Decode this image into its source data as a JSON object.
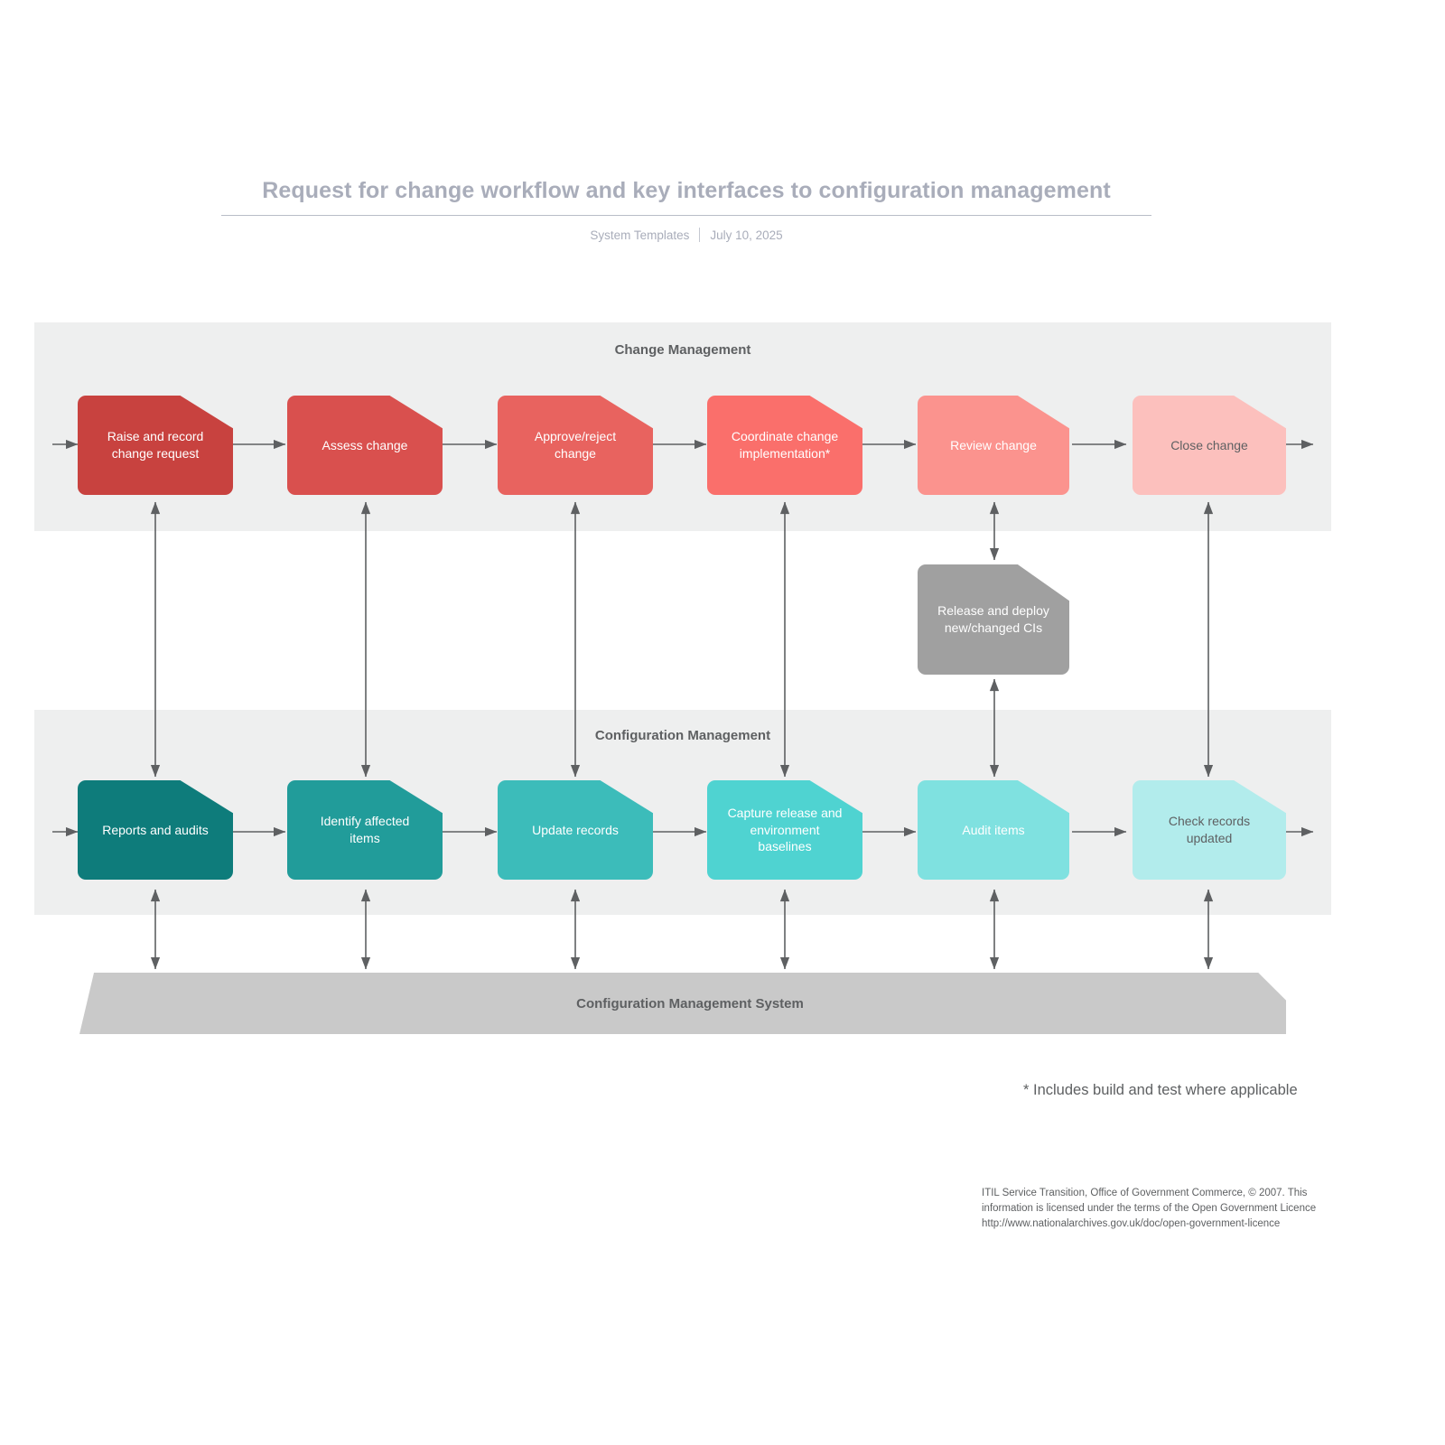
{
  "header": {
    "title": "Request for change workflow and key interfaces to configuration management",
    "source": "System Templates",
    "date": "July 10, 2025"
  },
  "lanes": [
    {
      "id": "change",
      "title": "Change Management"
    },
    {
      "id": "config",
      "title": "Configuration Management"
    }
  ],
  "change_row": [
    {
      "label": "Raise and record\nchange request",
      "color": "#c8423f",
      "text_color": "#ffffff"
    },
    {
      "label": "Assess change",
      "color": "#d9504e",
      "text_color": "#ffffff"
    },
    {
      "label": "Approve/reject\nchange",
      "color": "#e8635f",
      "text_color": "#ffffff"
    },
    {
      "label": "Coordinate change\nimplementation*",
      "color": "#fa6f6b",
      "text_color": "#ffffff"
    },
    {
      "label": "Review change",
      "color": "#fb938e",
      "text_color": "#ffffff"
    },
    {
      "label": "Close change",
      "color": "#fcc0bd",
      "text_color": "#5e6062"
    }
  ],
  "config_row": [
    {
      "label": "Reports and audits",
      "color": "#0e7c7b",
      "text_color": "#ffffff"
    },
    {
      "label": "Identify affected\nitems",
      "color": "#219c9a",
      "text_color": "#ffffff"
    },
    {
      "label": "Update records",
      "color": "#3cbcba",
      "text_color": "#ffffff"
    },
    {
      "label": "Capture release and\nenvironment\nbaselines",
      "color": "#4fd3d1",
      "text_color": "#ffffff"
    },
    {
      "label": "Audit items",
      "color": "#7fe1e0",
      "text_color": "#ffffff"
    },
    {
      "label": "Check records\nupdated",
      "color": "#b2ecec",
      "text_color": "#5e6062"
    }
  ],
  "release_node": {
    "label": "Release and deploy\nnew/changed CIs",
    "color": "#a0a0a0",
    "text_color": "#ffffff"
  },
  "cms_bar": {
    "label": "Configuration Management System",
    "color": "#c9c9c9"
  },
  "footnote": "* Includes build and test where applicable",
  "attribution": [
    "ITIL Service Transition, Office of Government Commerce, © 2007. This",
    "information is licensed under the terms of the Open Government Licence",
    "http://www.nationalarchives.gov.uk/doc/open-government-licence"
  ],
  "colors": {
    "lane_background": "#eeefef",
    "connector": "#5e6062",
    "title": "#a9adba",
    "body_text": "#5e6062"
  }
}
